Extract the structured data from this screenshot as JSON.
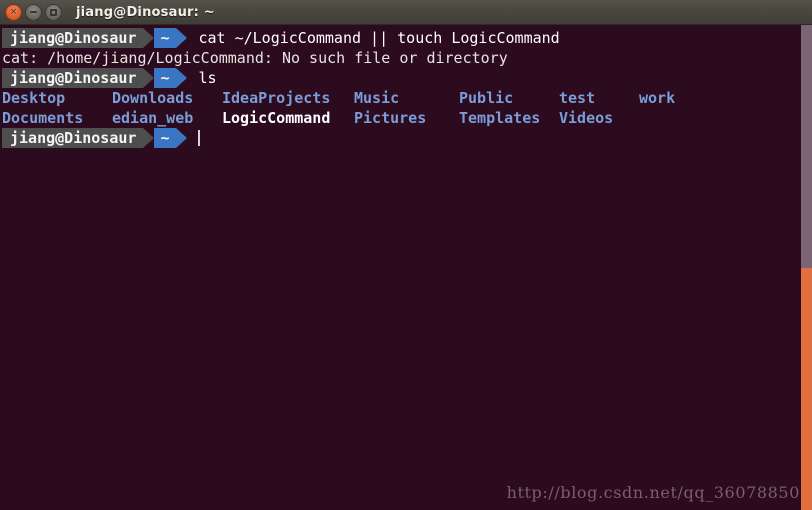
{
  "window": {
    "title": "jiang@Dinosaur: ~",
    "controls": {
      "close_label": "×",
      "minimize_label": "",
      "maximize_label": ""
    }
  },
  "prompt": {
    "user_host": "jiang@Dinosaur",
    "path": "~"
  },
  "terminal": {
    "lines": [
      {
        "type": "prompt",
        "command": "cat ~/LogicCommand || touch LogicCommand"
      },
      {
        "type": "output",
        "text": "cat: /home/jiang/LogicCommand: No such file or directory"
      },
      {
        "type": "prompt",
        "command": "ls"
      }
    ],
    "ls_output": {
      "row1": [
        {
          "name": "Desktop",
          "kind": "dir"
        },
        {
          "name": "Downloads",
          "kind": "dir"
        },
        {
          "name": "IdeaProjects",
          "kind": "dir"
        },
        {
          "name": "Music",
          "kind": "dir"
        },
        {
          "name": "Public",
          "kind": "dir"
        },
        {
          "name": "test",
          "kind": "dir"
        },
        {
          "name": "work",
          "kind": "dir"
        }
      ],
      "row2": [
        {
          "name": "Documents",
          "kind": "dir"
        },
        {
          "name": "edian_web",
          "kind": "dir"
        },
        {
          "name": "LogicCommand",
          "kind": "file"
        },
        {
          "name": "Pictures",
          "kind": "dir"
        },
        {
          "name": "Templates",
          "kind": "dir"
        },
        {
          "name": "Videos",
          "kind": "dir"
        }
      ]
    },
    "final_prompt": {
      "command": ""
    }
  },
  "watermark": "http://blog.csdn.net/qq_36078850",
  "colors": {
    "background": "#2c0b1e",
    "directory": "#7a9dd8",
    "file": "#ffffff",
    "prompt_user_bg": "#4e4e4e",
    "prompt_path_bg": "#3a76c4",
    "titlebar": "#4a4740",
    "scrollbar_thumb": "#e0713f",
    "scrollbar_track": "#7b6474",
    "watermark_text": "#7d5f6b"
  }
}
